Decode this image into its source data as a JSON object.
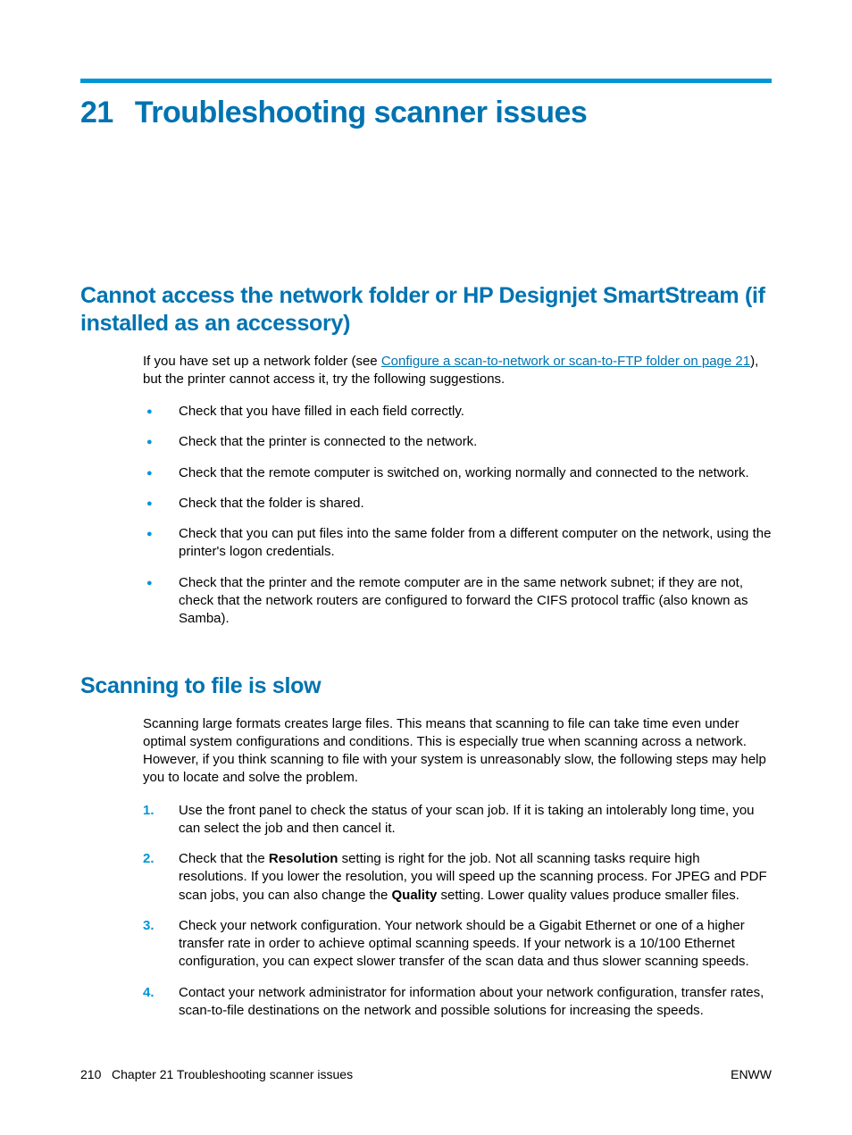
{
  "chapter": {
    "number": "21",
    "title": "Troubleshooting scanner issues"
  },
  "section1": {
    "title": "Cannot access the network folder or HP Designjet SmartStream (if installed as an accessory)",
    "intro_pre": "If you have set up a network folder (see ",
    "intro_link": "Configure a scan-to-network or scan-to-FTP folder on page 21",
    "intro_post": "), but the printer cannot access it, try the following suggestions.",
    "bullets": [
      "Check that you have filled in each field correctly.",
      "Check that the printer is connected to the network.",
      "Check that the remote computer is switched on, working normally and connected to the network.",
      "Check that the folder is shared.",
      "Check that you can put files into the same folder from a different computer on the network, using the printer's logon credentials.",
      "Check that the printer and the remote computer are in the same network subnet; if they are not, check that the network routers are configured to forward the CIFS protocol traffic (also known as Samba)."
    ]
  },
  "section2": {
    "title": "Scanning to file is slow",
    "intro": "Scanning large formats creates large files. This means that scanning to file can take time even under optimal system configurations and conditions. This is especially true when scanning across a network. However, if you think scanning to file with your system is unreasonably slow, the following steps may help you to locate and solve the problem.",
    "steps": {
      "s1": "Use the front panel to check the status of your scan job. If it is taking an intolerably long time, you can select the job and then cancel it.",
      "s2_pre": "Check that the ",
      "s2_b1": "Resolution",
      "s2_mid": " setting is right for the job. Not all scanning tasks require high resolutions. If you lower the resolution, you will speed up the scanning process. For JPEG and PDF scan jobs, you can also change the ",
      "s2_b2": "Quality",
      "s2_post": " setting. Lower quality values produce smaller files.",
      "s3": "Check your network configuration. Your network should be a Gigabit Ethernet or one of a higher transfer rate in order to achieve optimal scanning speeds. If your network is a 10/100 Ethernet configuration, you can expect slower transfer of the scan data and thus slower scanning speeds.",
      "s4": "Contact your network administrator for information about your network configuration, transfer rates, scan-to-file destinations on the network and possible solutions for increasing the speeds."
    },
    "nums": {
      "n1": "1.",
      "n2": "2.",
      "n3": "3.",
      "n4": "4."
    }
  },
  "footer": {
    "page": "210",
    "chapter_label": "Chapter 21   Troubleshooting scanner issues",
    "right": "ENWW"
  }
}
